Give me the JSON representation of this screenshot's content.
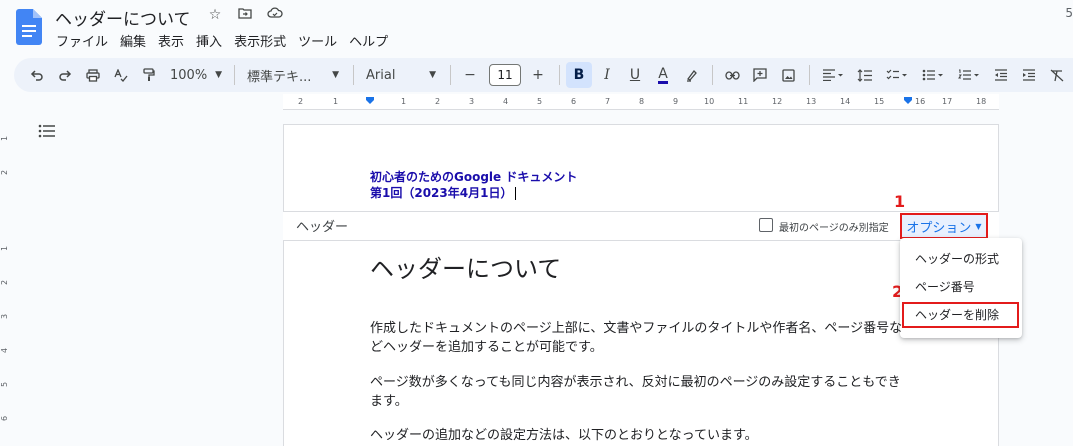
{
  "app": {
    "title": "ヘッダーについて",
    "edge_number": "5",
    "menu": [
      "ファイル",
      "編集",
      "表示",
      "挿入",
      "表示形式",
      "ツール",
      "ヘルプ"
    ]
  },
  "toolbar": {
    "zoom": "100%",
    "style": "標準テキ...",
    "font": "Arial",
    "font_size": "11",
    "minus": "−",
    "plus": "+"
  },
  "ruler": {
    "ticks": [
      "2",
      "1",
      "1",
      "2",
      "3",
      "4",
      "5",
      "6",
      "7",
      "8",
      "9",
      "10",
      "11",
      "12",
      "13",
      "14",
      "15",
      "16",
      "17",
      "18"
    ]
  },
  "vruler": {
    "ticks": [
      "1",
      "2",
      "1",
      "2",
      "3",
      "4",
      "5",
      "6"
    ]
  },
  "header": {
    "line1": "初心者のためのGoogle ドキュメント",
    "line2": "第1回（2023年4月1日）",
    "label": "ヘッダー",
    "first_page_label": "最初のページのみ別指定",
    "options_label": "オプション"
  },
  "options_menu": {
    "items": [
      "ヘッダーの形式",
      "ページ番号",
      "ヘッダーを削除"
    ]
  },
  "annotations": {
    "step1": "1",
    "step2": "2"
  },
  "body": {
    "heading": "ヘッダーについて",
    "p1_line1": "作成したドキュメントのページ上部に、文書やファイルのタイトルや作者名、ページ番号な",
    "p1_line2": "どヘッダーを追加することが可能です。",
    "p2_line1": "ページ数が多くなっても同じ内容が表示され、反対に最初のページのみ設定することもでき",
    "p2_line2": "ます。",
    "p3_line1": "ヘッダーの追加などの設定方法は、以下のとおりとなっています。"
  },
  "colors": {
    "header_text": "#1a0dab",
    "annotation": "#e31b1b",
    "link": "#1a73e8"
  }
}
